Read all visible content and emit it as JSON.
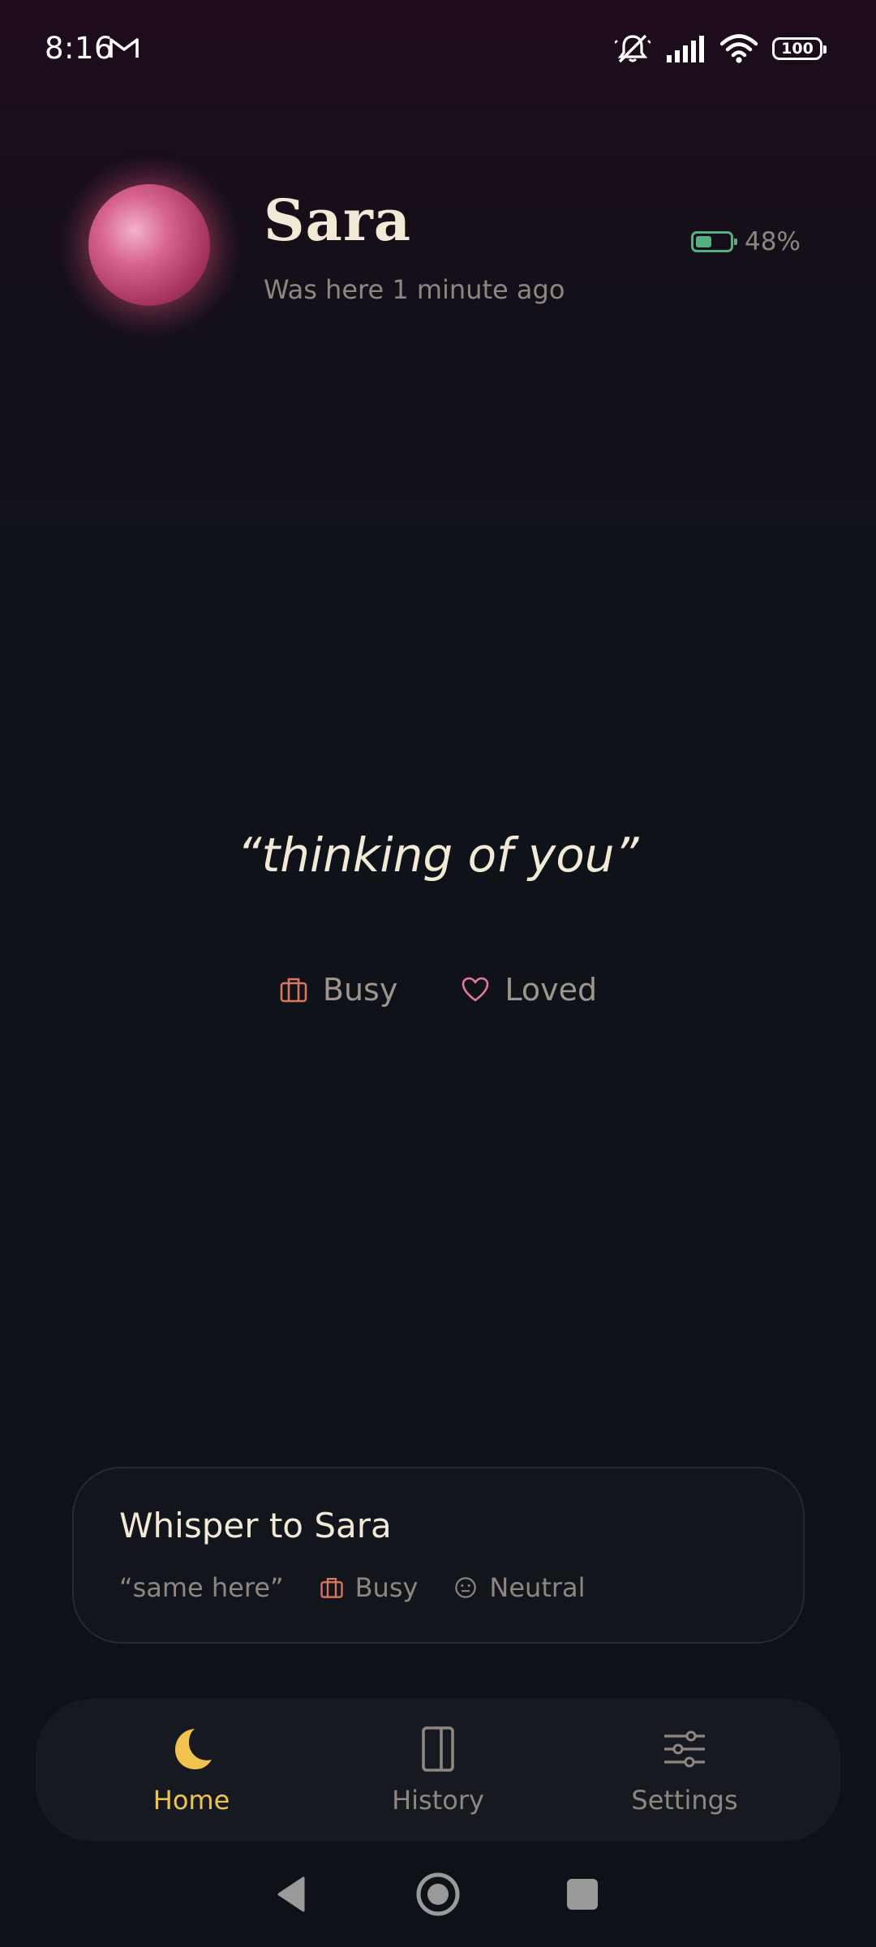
{
  "status_bar": {
    "time": "8:16",
    "phone_battery": "100",
    "icons": [
      "gmail-icon",
      "mute-icon",
      "signal-icon",
      "wifi-icon",
      "battery-icon"
    ]
  },
  "profile": {
    "name": "Sara",
    "last_seen": "Was here 1 minute ago",
    "battery": {
      "text": "48%",
      "level": 0.48,
      "color": "#56b07e"
    },
    "avatar_color": "#d7648f"
  },
  "status": {
    "quote": "“thinking of you”",
    "moods": [
      {
        "label": "Busy",
        "icon": "briefcase-icon",
        "color": "#d9765f"
      },
      {
        "label": "Loved",
        "icon": "heart-icon",
        "color": "#e37a9d"
      }
    ]
  },
  "whisper": {
    "title": "Whisper to Sara",
    "quote": "“same here”",
    "moods": [
      {
        "label": "Busy",
        "icon": "briefcase-icon"
      },
      {
        "label": "Neutral",
        "icon": "neutral-face-icon"
      }
    ]
  },
  "nav": {
    "items": [
      {
        "label": "Home",
        "icon": "moon-icon",
        "active": true
      },
      {
        "label": "History",
        "icon": "book-icon",
        "active": false
      },
      {
        "label": "Settings",
        "icon": "sliders-icon",
        "active": false
      }
    ],
    "active_color": "#f2c24e"
  },
  "system_nav": {
    "icons": [
      "back-icon",
      "home-icon",
      "recents-icon"
    ]
  }
}
